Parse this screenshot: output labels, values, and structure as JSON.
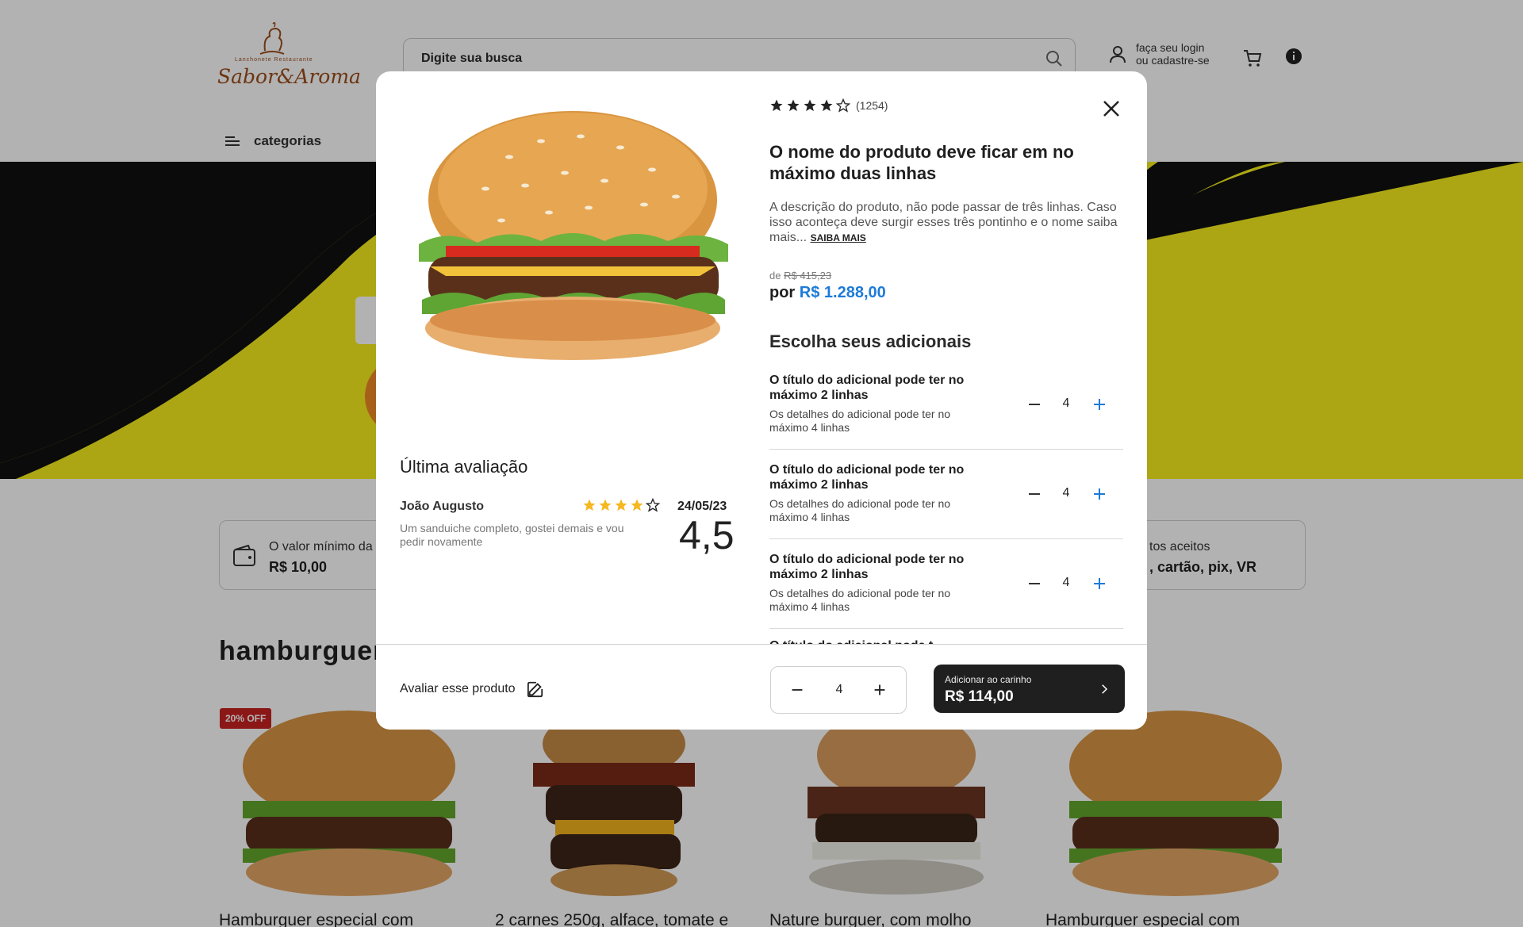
{
  "header": {
    "logo_text": "Sabor&Aroma",
    "logo_subtext": "Lanchonete   Restaurante",
    "search_placeholder": "Digite sua busca",
    "login_line1": "faça seu login",
    "login_line2": "ou cadastre-se",
    "categories_label": "categorias"
  },
  "info_bar": {
    "left_label": "O valor mínimo da",
    "left_value": "R$ 10,00",
    "right_label": "tos aceitos",
    "right_value": ", cartão, pix, VR"
  },
  "section": {
    "title": "hamburguer",
    "badge": "20% OFF",
    "products": [
      "Hamburguer especial com",
      "2 carnes 250g, alface, tomate e",
      "Nature burguer, com molho",
      "Hamburguer especial com"
    ]
  },
  "modal": {
    "rating_count": "(1254)",
    "rating_stars": 4,
    "title": "O nome do produto deve ficar em no máximo duas linhas",
    "description": "A descrição do produto, não pode passar de três linhas. Caso isso aconteça deve surgir esses três pontinho e o nome saiba mais...",
    "read_more": "SAIBA MAIS",
    "old_price_prefix": "de",
    "old_price": "R$ 415,23",
    "new_price_prefix": "por",
    "new_price": "R$ 1.288,00",
    "addons_title": "Escolha seus adicionais",
    "addons": [
      {
        "title": "O título do adicional pode ter no máximo 2 linhas",
        "detail": "Os detalhes do adicional pode ter no máximo 4 linhas",
        "qty": "4"
      },
      {
        "title": "O título do adicional pode ter no máximo 2 linhas",
        "detail": "Os detalhes do adicional pode ter no máximo 4 linhas",
        "qty": "4"
      },
      {
        "title": "O título do adicional pode ter no máximo 2 linhas",
        "detail": "Os detalhes do adicional pode ter no máximo 4 linhas",
        "qty": "4"
      }
    ],
    "addon_peek": "O título do adicional pode t",
    "review": {
      "title": "Última avaliação",
      "author": "João Augusto",
      "stars": 4,
      "date": "24/05/23",
      "text": "Um sanduiche completo, gostei demais e vou pedir novamente",
      "score": "4,5"
    },
    "footer": {
      "rate_label": "Avaliar esse produto",
      "quantity": "4",
      "add_label": "Adicionar ao carinho",
      "add_price": "R$ 114,00"
    }
  },
  "colors": {
    "accent_blue": "#1d7bd8",
    "hero_yellow": "#f7ee1e",
    "button_dark": "#1f1f1f",
    "star_gold": "#f5b820"
  }
}
